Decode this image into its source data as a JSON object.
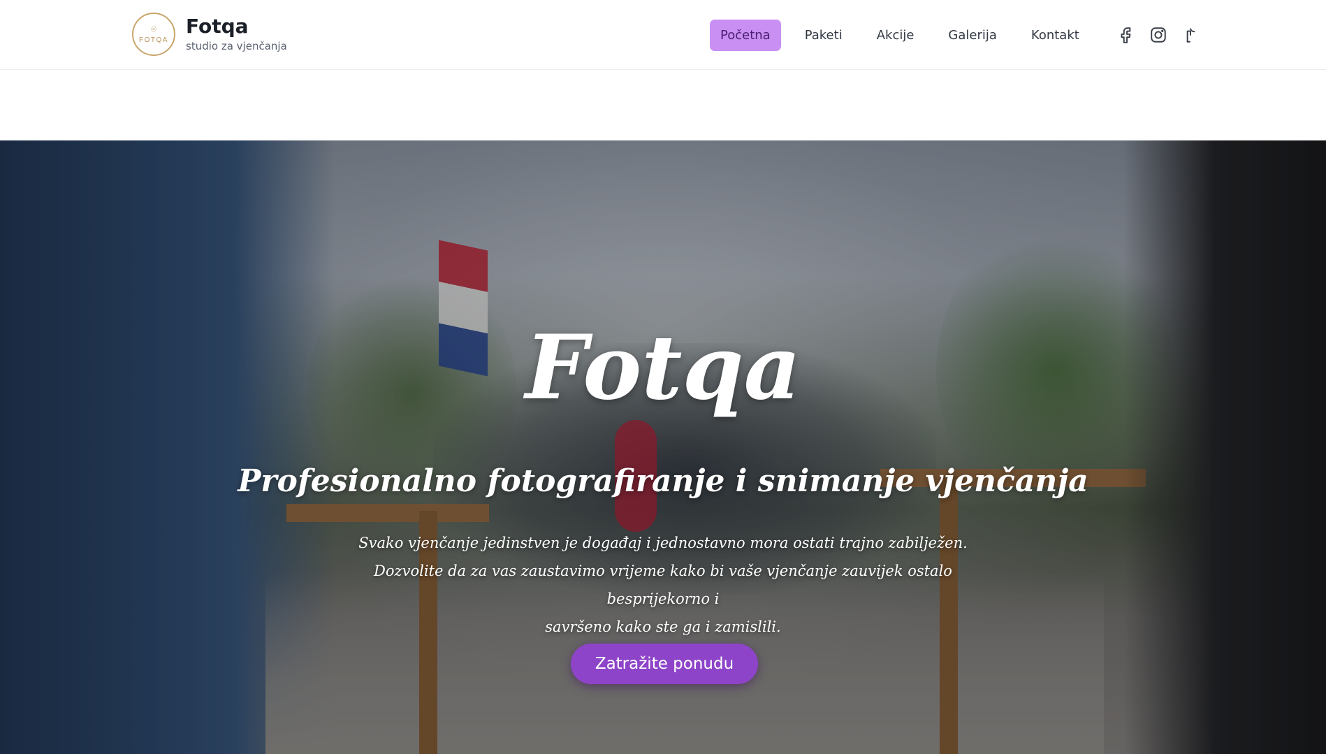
{
  "brand": {
    "logo_text": "FOTQA",
    "name": "Fotqa",
    "tagline": "studio za vjenčanja"
  },
  "nav": {
    "items": [
      {
        "label": "Početna",
        "active": true
      },
      {
        "label": "Paketi",
        "active": false
      },
      {
        "label": "Akcije",
        "active": false
      },
      {
        "label": "Galerija",
        "active": false
      },
      {
        "label": "Kontakt",
        "active": false
      }
    ],
    "active_color": "#c98ff2"
  },
  "socials": [
    {
      "icon": "facebook-icon"
    },
    {
      "icon": "instagram-icon"
    },
    {
      "icon": "tiktok-icon"
    }
  ],
  "hero": {
    "title": "Fotqa",
    "subtitle": "Profesionalno fotografiranje i snimanje vjenčanja",
    "description_lines": [
      "Svako vjenčanje jedinstven je događaj i jednostavno mora ostati trajno zabilježen.",
      "Dozvolite da za vas zaustavimo vrijeme kako bi vaše vjenčanje zauvijek ostalo besprijekorno i",
      "savršeno kako ste ga i zamislili."
    ],
    "cta_label": "Zatražite ponudu",
    "cta_color": "#8e44c9"
  }
}
